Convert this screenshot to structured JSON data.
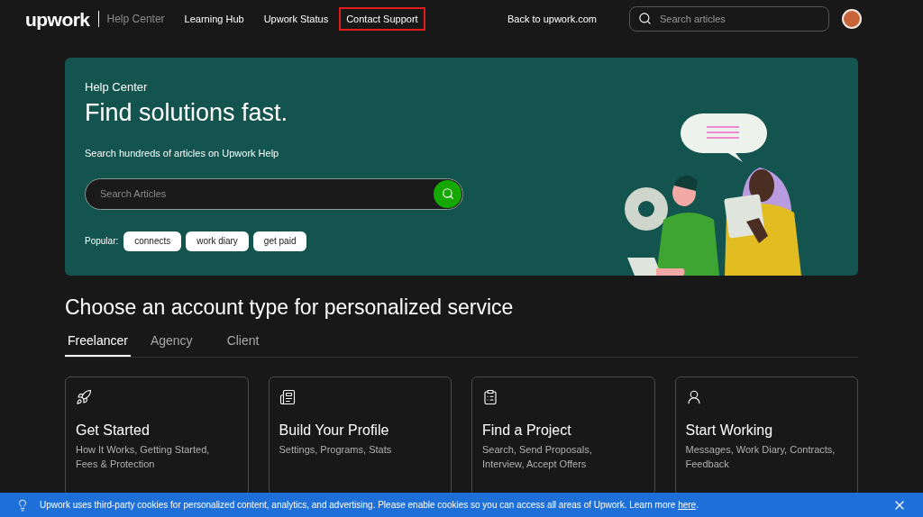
{
  "header": {
    "logo": "upwork",
    "section": "Help Center",
    "nav": [
      {
        "label": "Learning Hub",
        "highlighted": false
      },
      {
        "label": "Upwork Status",
        "highlighted": false
      },
      {
        "label": "Contact Support",
        "highlighted": true
      }
    ],
    "back_link": "Back to upwork.com",
    "search": {
      "placeholder": "Search articles"
    }
  },
  "hero": {
    "eyebrow": "Help Center",
    "title": "Find solutions fast.",
    "subtitle": "Search hundreds of articles on Upwork Help",
    "search": {
      "placeholder": "Search Articles"
    },
    "popular_label": "Popular:",
    "popular": [
      "connects",
      "work diary",
      "get paid"
    ]
  },
  "account_section": {
    "title": "Choose an account type for personalized service",
    "tabs": [
      {
        "label": "Freelancer",
        "selected": true
      },
      {
        "label": "Agency",
        "selected": false
      },
      {
        "label": "Client",
        "selected": false
      }
    ],
    "cards": [
      {
        "title": "Get Started",
        "description": "How It Works, Getting Started, Fees & Protection"
      },
      {
        "title": "Build Your Profile",
        "description": "Settings, Programs, Stats"
      },
      {
        "title": "Find a Project",
        "description": "Search, Send Proposals, Interview, Accept Offers"
      },
      {
        "title": "Start Working",
        "description": "Messages, Work Diary, Contracts, Feedback"
      }
    ]
  },
  "cookie_banner": {
    "text": "Upwork uses third-party cookies for personalized content, analytics, and advertising. Please enable cookies so you can access all areas of Upwork. Learn more",
    "link": "here",
    "suffix": "."
  }
}
